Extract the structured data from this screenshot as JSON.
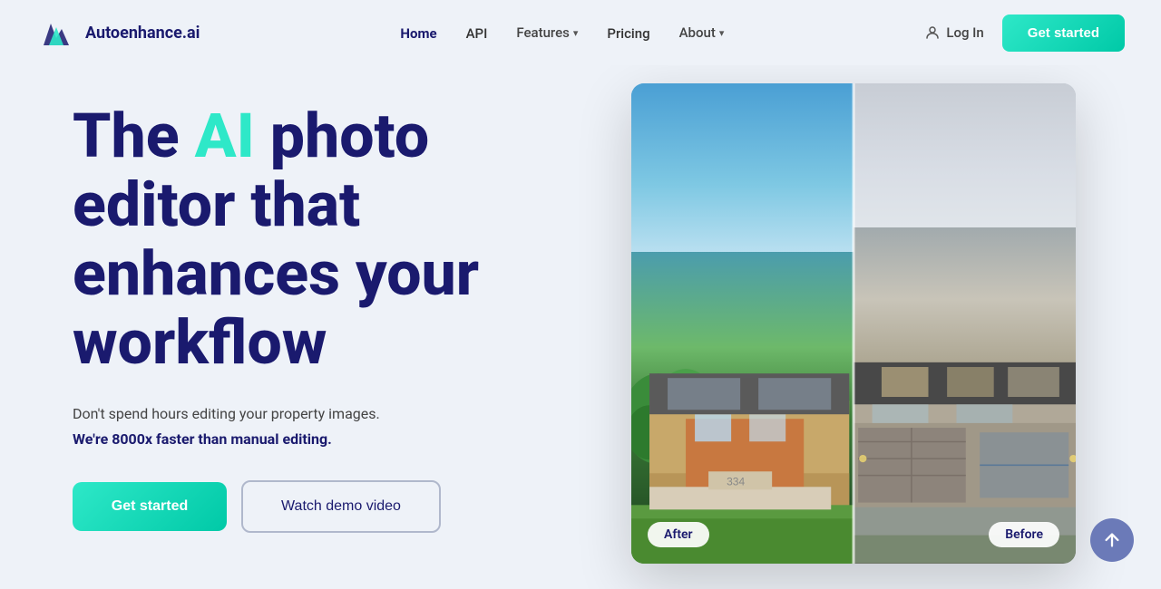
{
  "brand": {
    "name": "Autoenhance.ai"
  },
  "navbar": {
    "logo_text": "Autoenhance.ai",
    "links": [
      {
        "label": "Home",
        "active": true
      },
      {
        "label": "API",
        "active": false
      },
      {
        "label": "Features",
        "active": false,
        "dropdown": true
      },
      {
        "label": "Pricing",
        "active": false
      },
      {
        "label": "About",
        "active": false,
        "dropdown": true
      }
    ],
    "login_label": "Log In",
    "get_started_label": "Get started"
  },
  "hero": {
    "title_part1": "The ",
    "title_ai": "AI",
    "title_part2": " photo editor that enhances your workflow",
    "subtitle": "Don't spend hours editing your property images.",
    "subtitle_bold": "We're 8000x faster than manual editing.",
    "btn_get_started": "Get started",
    "btn_watch_demo": "Watch demo video"
  },
  "image_labels": {
    "after": "After",
    "before": "Before"
  },
  "colors": {
    "accent_teal": "#2ee8c8",
    "brand_dark_blue": "#1a1a6e",
    "bg": "#eef2f8"
  }
}
